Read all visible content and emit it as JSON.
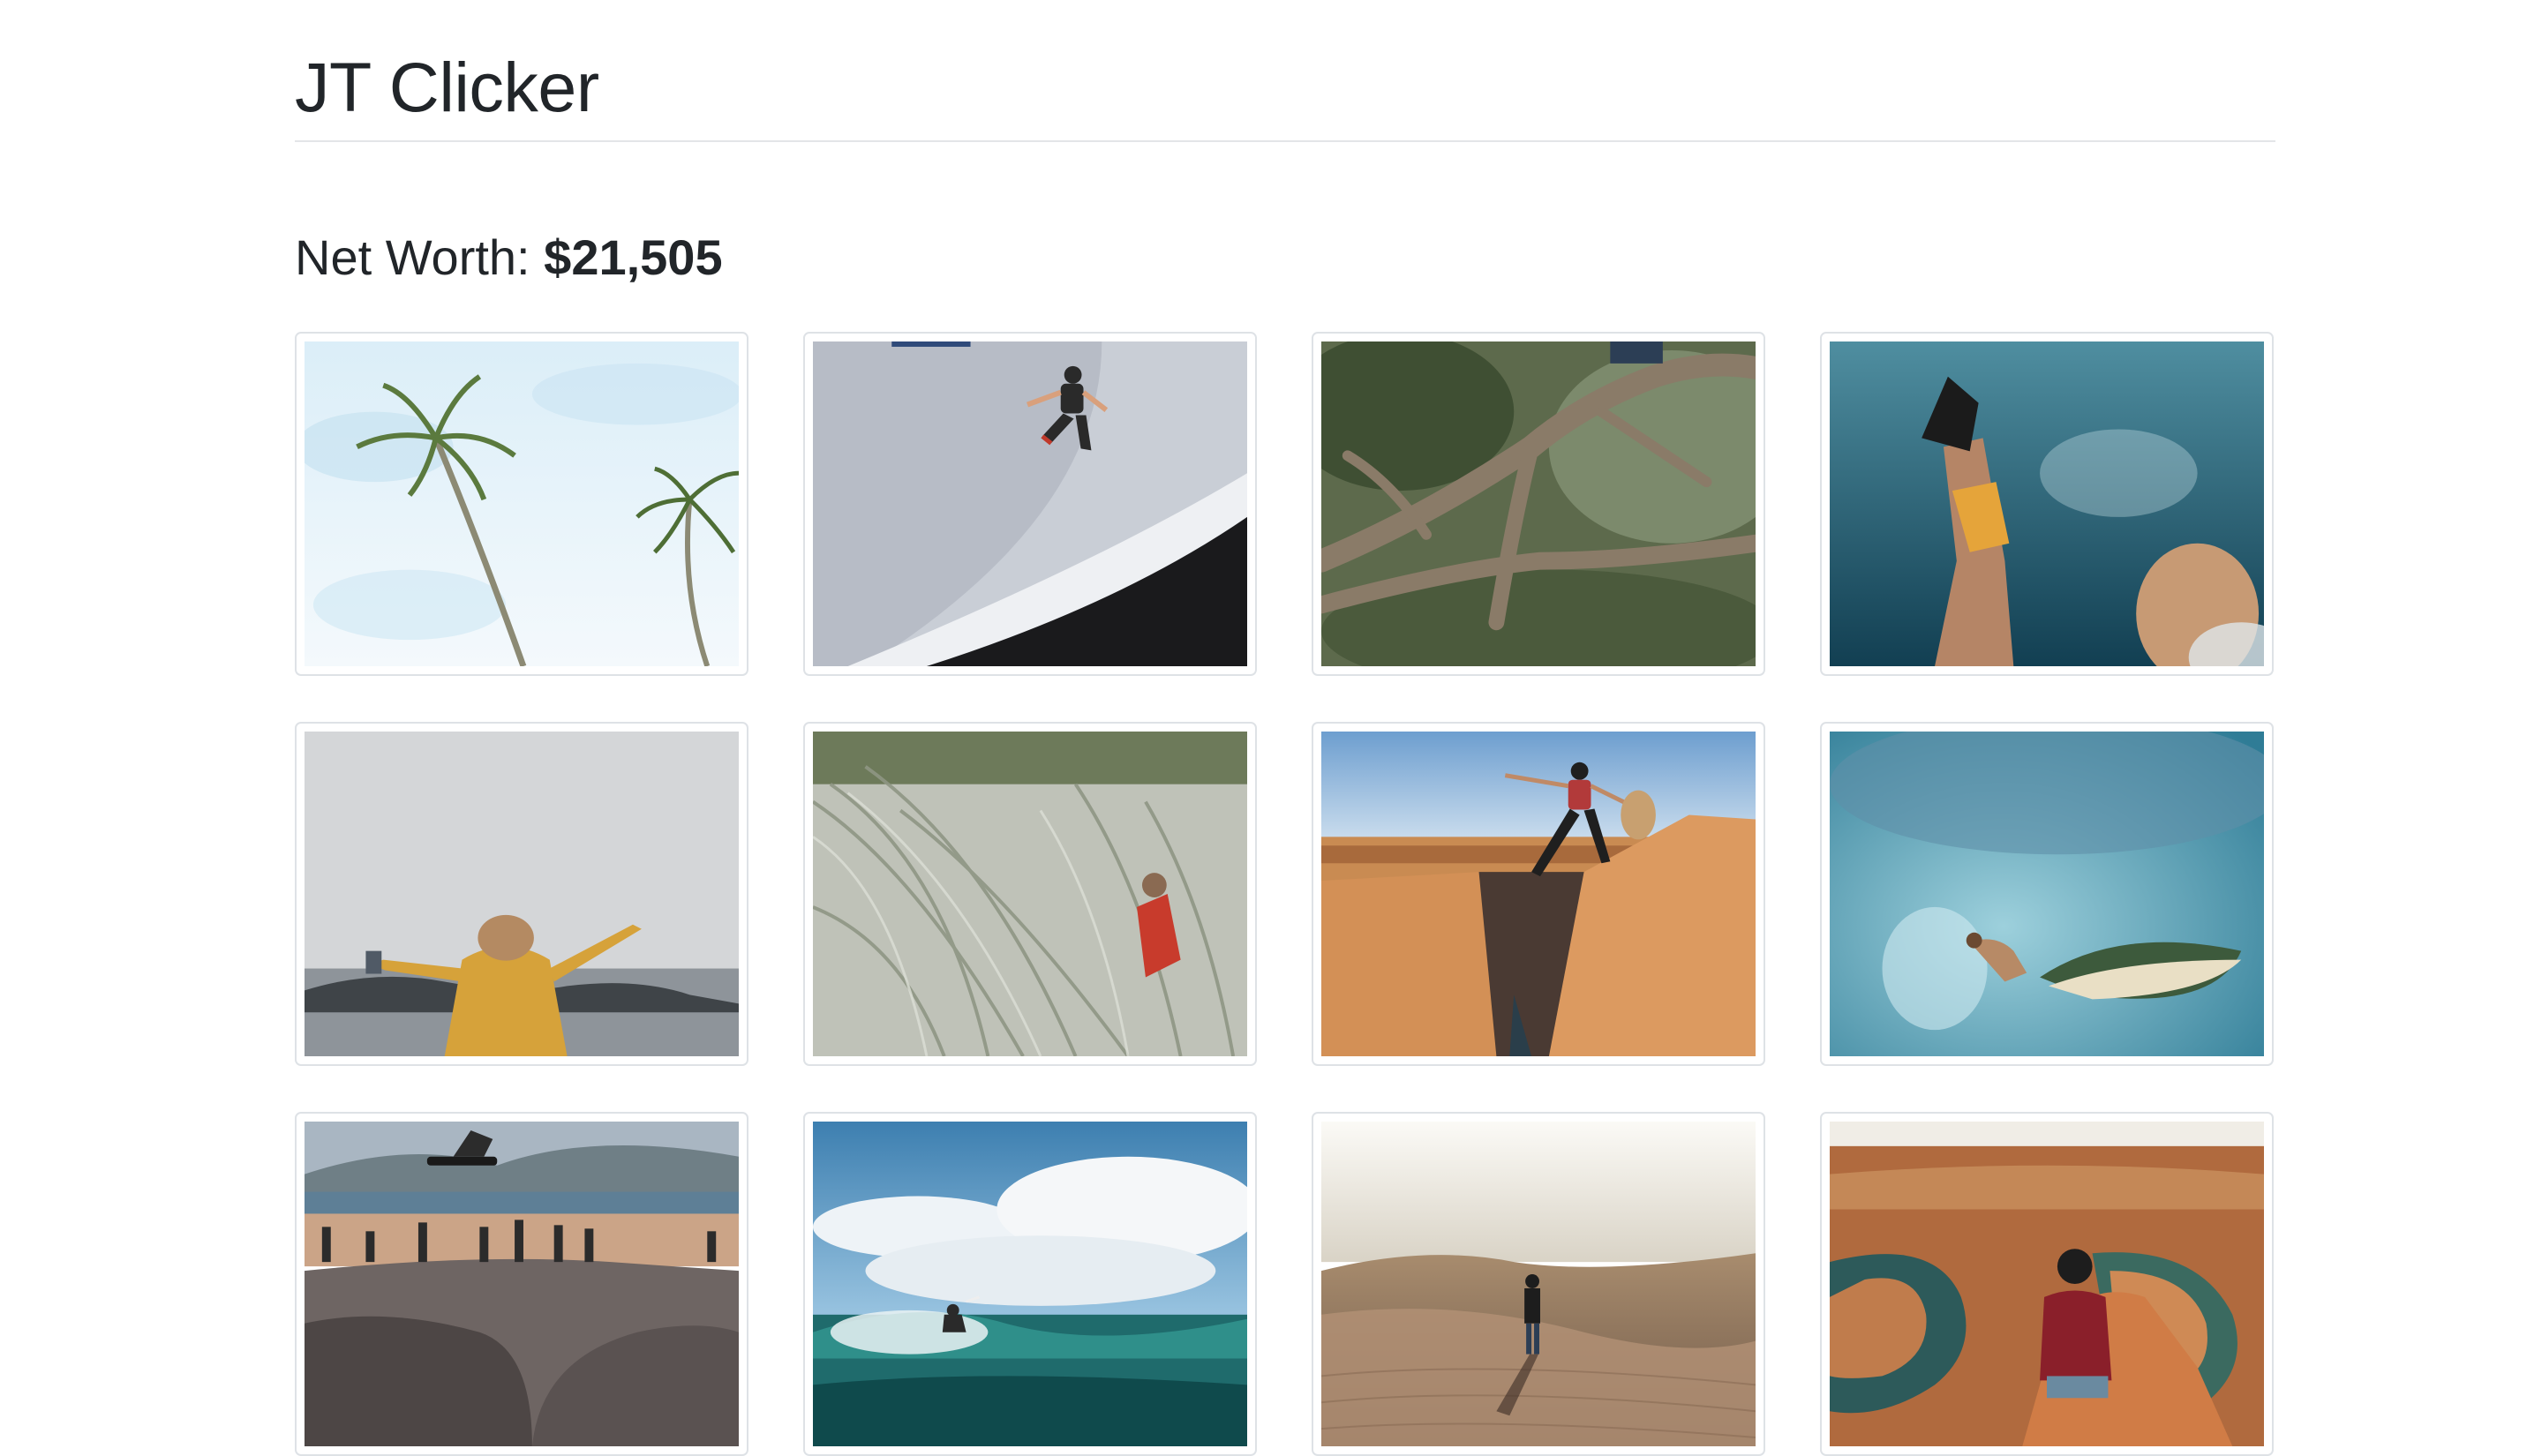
{
  "header": {
    "title": "JT Clicker"
  },
  "net_worth": {
    "label": "Net Worth:",
    "value": "$21,505"
  },
  "gallery": {
    "items": [
      {
        "name": "palm-trees-photo"
      },
      {
        "name": "jumping-man-photo"
      },
      {
        "name": "tree-branches-photo"
      },
      {
        "name": "underwater-fins-photo"
      },
      {
        "name": "coat-arms-open-photo"
      },
      {
        "name": "dune-grass-photo"
      },
      {
        "name": "canyon-jump-photo"
      },
      {
        "name": "wave-barrel-surfer-photo"
      },
      {
        "name": "skatepark-jump-photo"
      },
      {
        "name": "surfer-clouds-photo"
      },
      {
        "name": "desert-dunes-walker-photo"
      },
      {
        "name": "horseshoe-bend-photo"
      }
    ]
  }
}
